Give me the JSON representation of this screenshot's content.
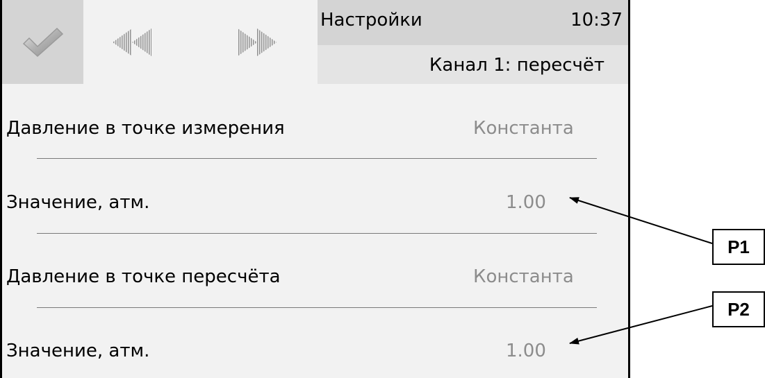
{
  "header": {
    "title": "Настройки",
    "time": "10:37",
    "subtitle": "Канал 1: пересчёт",
    "ok_icon": "check-icon",
    "prev_icon": "double-left-arrow-icon",
    "next_icon": "double-right-arrow-icon"
  },
  "rows": [
    {
      "label": "Давление в точке измерения",
      "value": "Константа"
    },
    {
      "label": "Значение, атм.",
      "value": "1.00"
    },
    {
      "label": "Давление в точке пересчёта",
      "value": "Константа"
    },
    {
      "label": "Значение, атм.",
      "value": "1.00"
    }
  ],
  "callouts": [
    {
      "label": "P1"
    },
    {
      "label": "P2"
    }
  ],
  "colors": {
    "header_dark": "#d4d4d4",
    "header_light": "#e4e4e4",
    "background": "#f2f2f2",
    "value_text": "#8c8c8c"
  }
}
